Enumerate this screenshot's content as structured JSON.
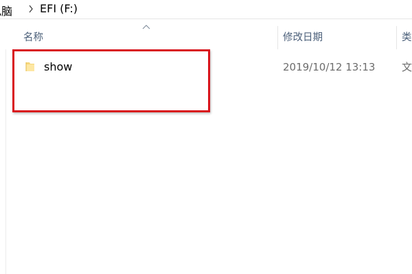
{
  "address_bar": {
    "computer_label": "电脑",
    "separator_icon": "chevron-right-icon",
    "drive_label": "EFI (F:)"
  },
  "columns": {
    "name_label": "名称",
    "date_label": "修改日期",
    "type_label": "类",
    "sort_icon": "sort-ascending-icon"
  },
  "files": [
    {
      "icon": "folder-icon",
      "name": "show",
      "modified": "2019/10/12 13:13",
      "type": "文"
    }
  ],
  "colors": {
    "highlight": "#d9141c",
    "header_text": "#4c607a",
    "folder": "#f5d67b"
  }
}
